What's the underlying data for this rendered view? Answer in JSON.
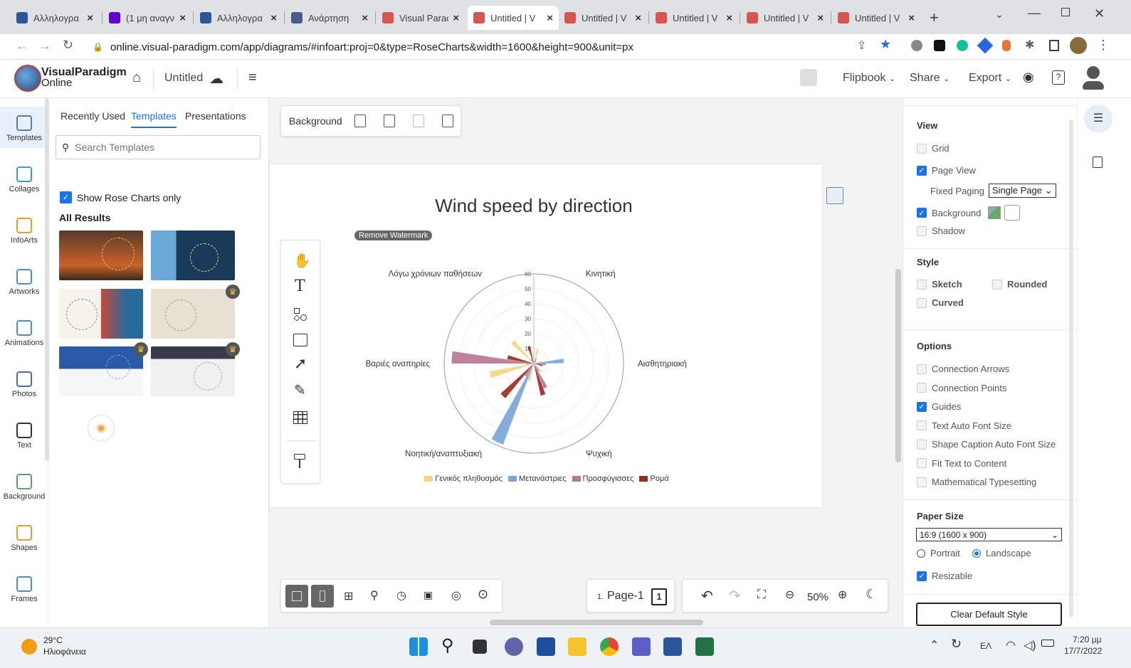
{
  "browser": {
    "tabs": [
      {
        "title": "Αλληλογρα",
        "color": "#2b579a",
        "active": false
      },
      {
        "title": "(1 μη αναγν",
        "color": "#6001d2",
        "active": false
      },
      {
        "title": "Αλληλογρα",
        "color": "#2b579a",
        "active": false
      },
      {
        "title": "Ανάρτηση",
        "color": "#4a5b8a",
        "active": false
      },
      {
        "title": "Visual Parac",
        "color": "#d9534f",
        "active": false
      },
      {
        "title": "Untitled | V",
        "color": "#d9534f",
        "active": true
      },
      {
        "title": "Untitled | V",
        "color": "#d9534f",
        "active": false
      },
      {
        "title": "Untitled | V",
        "color": "#d9534f",
        "active": false
      },
      {
        "title": "Untitled | V",
        "color": "#d9534f",
        "active": false
      },
      {
        "title": "Untitled | V",
        "color": "#d9534f",
        "active": false
      }
    ],
    "new_tab": "+",
    "url": "online.visual-paradigm.com/app/diagrams/#infoart:proj=0&type=RoseCharts&width=1600&height=900&unit=px"
  },
  "app": {
    "logo_line1": "VisualParadigm",
    "logo_line2": "Online",
    "doc_title": "Untitled",
    "flipbook": "Flipbook",
    "share": "Share",
    "export": "Export"
  },
  "rail": [
    {
      "label": "Templates",
      "icon": "templates-icon",
      "color": "#5b7ea8"
    },
    {
      "label": "Collages",
      "icon": "collages-icon",
      "color": "#3a9bd5"
    },
    {
      "label": "InfoArts",
      "icon": "infoarts-icon",
      "color": "#e0a030"
    },
    {
      "label": "Artworks",
      "icon": "artworks-icon",
      "color": "#4a90c8"
    },
    {
      "label": "Animations",
      "icon": "animations-icon",
      "color": "#4a90c8"
    },
    {
      "label": "Photos",
      "icon": "photos-icon",
      "color": "#4a6aa8"
    },
    {
      "label": "Text",
      "icon": "text-icon",
      "color": "#333"
    },
    {
      "label": "Background",
      "icon": "background-icon",
      "color": "#6a9a6a"
    },
    {
      "label": "Shapes",
      "icon": "shapes-icon",
      "color": "#e0a030"
    },
    {
      "label": "Frames",
      "icon": "frames-icon",
      "color": "#4a90c8"
    }
  ],
  "panel": {
    "tabs": [
      "Recently Used",
      "Templates",
      "Presentations"
    ],
    "search_placeholder": "Search Templates",
    "filter_label": "Show Rose Charts only",
    "results_heading": "All Results"
  },
  "canvas": {
    "background_label": "Background",
    "watermark": "Remove Watermark",
    "page_label": "Page-1",
    "page_number": "1.",
    "page_count": "1",
    "zoom": "50%"
  },
  "chart_data": {
    "type": "rose",
    "title": "Wind speed by direction",
    "radial_ticks": [
      10,
      20,
      30,
      40,
      50,
      60
    ],
    "rmax": 60,
    "directions": [
      "Κινητική",
      "Αισθητηριακή",
      "Ψυχική",
      "Νοητική/αναπτυξιακή",
      "Βαριές αναπηρίες",
      "Λόγω χρόνιων παθήσεων"
    ],
    "series": [
      {
        "name": "Γενικός πληθυσμός",
        "color": "#f6d57a",
        "values": [
          10,
          5,
          8,
          12,
          30,
          20
        ]
      },
      {
        "name": "Μετανάστριες",
        "color": "#7aa6d8",
        "values": [
          4,
          20,
          6,
          58,
          5,
          3
        ]
      },
      {
        "name": "Προσφύγισσες",
        "color": "#b77894",
        "values": [
          3,
          8,
          18,
          10,
          55,
          4
        ]
      },
      {
        "name": "Ρομά",
        "color": "#9e2a1c",
        "values": [
          2,
          6,
          22,
          30,
          18,
          12
        ]
      }
    ],
    "legend": "bottom"
  },
  "right": {
    "view_title": "View",
    "grid": "Grid",
    "page_view": "Page View",
    "fixed_paging": "Fixed Paging",
    "fixed_paging_value": "Single Page",
    "background": "Background",
    "shadow": "Shadow",
    "style_title": "Style",
    "sketch": "Sketch",
    "rounded": "Rounded",
    "curved": "Curved",
    "options_title": "Options",
    "options": [
      {
        "label": "Connection Arrows",
        "checked": false
      },
      {
        "label": "Connection Points",
        "checked": false
      },
      {
        "label": "Guides",
        "checked": true
      },
      {
        "label": "Text Auto Font Size",
        "checked": false
      },
      {
        "label": "Shape Caption Auto Font Size",
        "checked": false
      },
      {
        "label": "Fit Text to Content",
        "checked": false
      },
      {
        "label": "Mathematical Typesetting",
        "checked": false
      }
    ],
    "paper_title": "Paper Size",
    "paper_value": "16:9 (1600 x 900)",
    "portrait": "Portrait",
    "landscape": "Landscape",
    "resizable": "Resizable",
    "clear_style": "Clear Default Style"
  },
  "taskbar": {
    "temp": "29°C",
    "weather": "Ηλιοφάνεια",
    "lang": "ΕΛ",
    "time": "7:20 μμ",
    "date": "17/7/2022"
  }
}
